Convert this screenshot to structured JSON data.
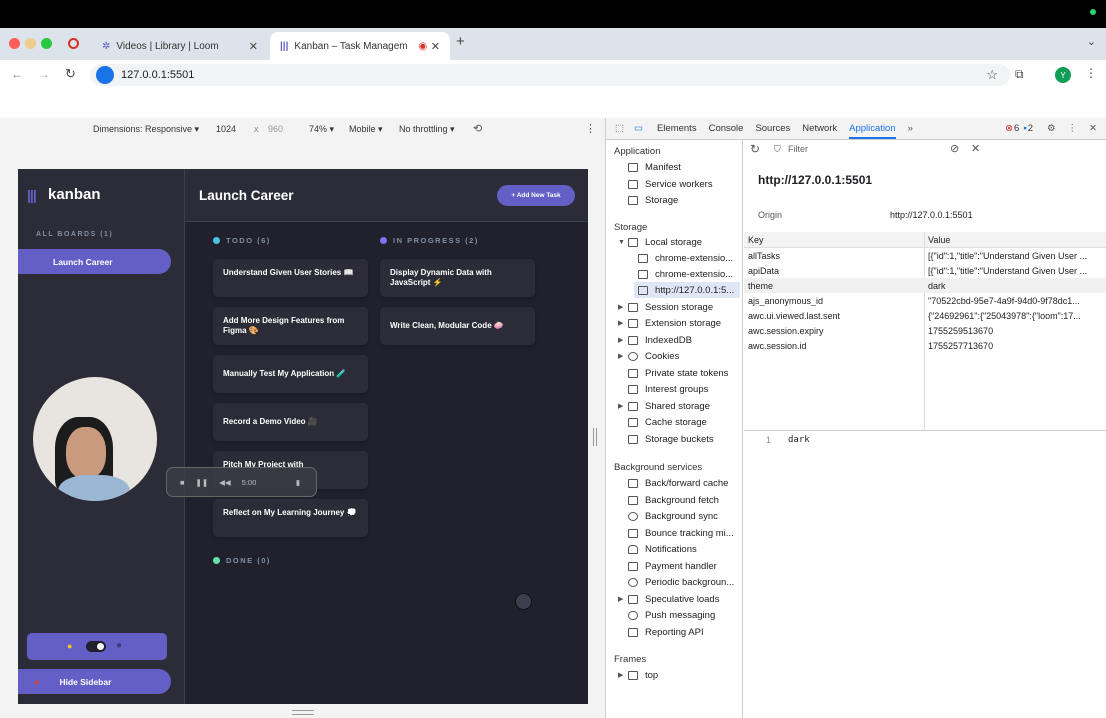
{
  "browser": {
    "tabs": [
      {
        "label": "Videos | Library | Loom"
      },
      {
        "label": "Kanban – Task Managem"
      }
    ],
    "url": "127.0.0.1:5501",
    "profile_initial": "Y"
  },
  "device_toolbar": {
    "dimensions_label": "Dimensions: Responsive",
    "width": "1024",
    "times": "x",
    "height": "960",
    "zoom": "74%",
    "device": "Mobile",
    "throttling": "No throttling"
  },
  "app": {
    "logo": "kanban",
    "all_boards": "ALL BOARDS (1)",
    "board_name": "Launch Career",
    "page_title": "Launch Career",
    "add_task": "+ Add New Task",
    "hide_sidebar": "Hide Sidebar",
    "columns": [
      {
        "title": "TODO (6)",
        "color": "#49c4e5",
        "cards": [
          "Understand Given User Stories 📖",
          "Add More Design Features from Figma 🎨",
          "Manually Test My Application 🧪",
          "Record a Demo Video 🎥",
          "Pitch My Project with",
          "Reflect on My Learning Journey 💭"
        ]
      },
      {
        "title": "IN PROGRESS (2)",
        "color": "#8471f2",
        "cards": [
          "Display Dynamic Data with JavaScript ⚡",
          "Write Clean, Modular Code 🧼"
        ]
      },
      {
        "title": "DONE (0)",
        "color": "#67e2ae",
        "cards": []
      }
    ],
    "media_time": "5:00",
    "accent": "#635fc7"
  },
  "devtools": {
    "tabs": [
      "Elements",
      "Console",
      "Sources",
      "Network",
      "Application"
    ],
    "errors": "6",
    "messages": "2",
    "application": "Application",
    "app_items": [
      "Manifest",
      "Service workers",
      "Storage"
    ],
    "storage": "Storage",
    "storage_items": [
      "Local storage",
      "chrome-extensio...",
      "chrome-extensio...",
      "http://127.0.0.1:5...",
      "Session storage",
      "Extension storage",
      "IndexedDB",
      "Cookies",
      "Private state tokens",
      "Interest groups",
      "Shared storage",
      "Cache storage",
      "Storage buckets"
    ],
    "background_services": "Background services",
    "bg_items": [
      "Back/forward cache",
      "Background fetch",
      "Background sync",
      "Bounce tracking mi...",
      "Notifications",
      "Payment handler",
      "Periodic backgroun...",
      "Speculative loads",
      "Push messaging",
      "Reporting API"
    ],
    "frames": "Frames",
    "frame_items": [
      "top"
    ],
    "filter_placeholder": "Filter",
    "origin_title": "http://127.0.0.1:5501",
    "origin_label": "Origin",
    "origin_value": "http://127.0.0.1:5501",
    "table_headers": [
      "Key",
      "Value"
    ],
    "rows": [
      {
        "key": "allTasks",
        "value": "[{\"id\":1,\"title\":\"Understand Given User ..."
      },
      {
        "key": "apiData",
        "value": "[{\"id\":1,\"title\":\"Understand Given User ..."
      },
      {
        "key": "theme",
        "value": "dark"
      },
      {
        "key": "ajs_anonymous_id",
        "value": "\"70522cbd-95e7-4a9f-94d0-9f78dc1..."
      },
      {
        "key": "awc.ui.viewed.last.sent",
        "value": "{\"24692961\":{\"25043978\":{\"loom\":17..."
      },
      {
        "key": "awc.session.expiry",
        "value": "1755259513670"
      },
      {
        "key": "awc.session.id",
        "value": "1755257713670"
      }
    ],
    "preview_line": "1",
    "preview_value": "dark"
  }
}
